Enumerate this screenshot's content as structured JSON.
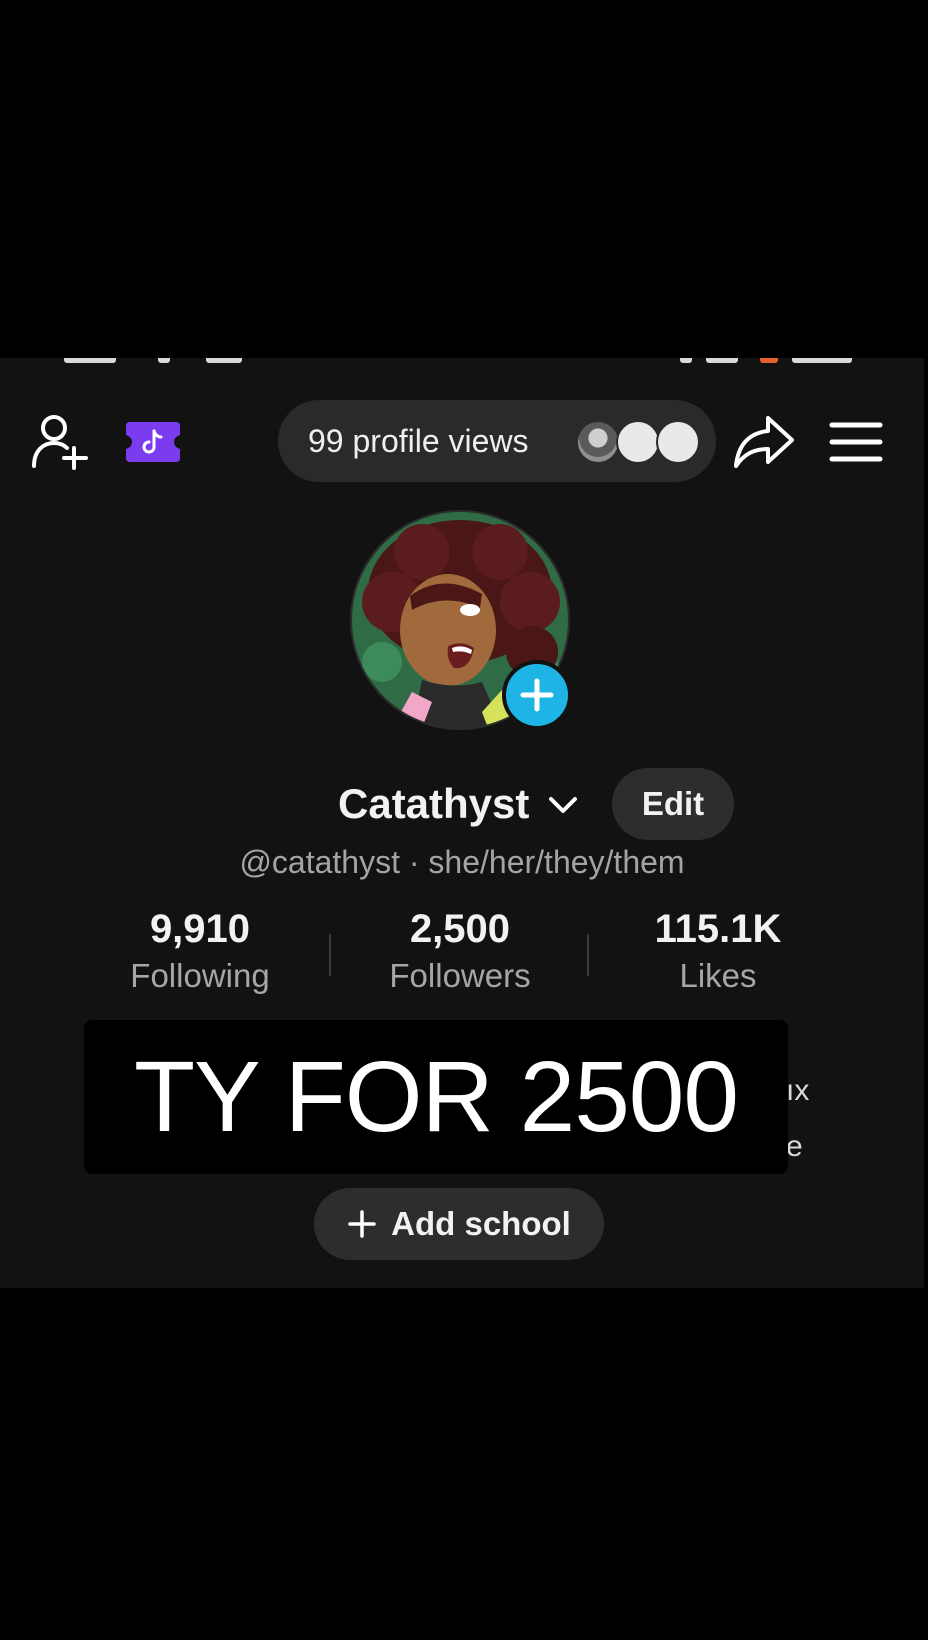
{
  "header": {
    "profile_views_label": "99 profile views"
  },
  "profile": {
    "display_name": "Catathyst",
    "edit_label": "Edit",
    "handle_line": "@catathyst · she/her/they/them"
  },
  "stats": [
    {
      "value": "9,910",
      "label": "Following"
    },
    {
      "value": "2,500",
      "label": "Followers"
    },
    {
      "value": "115.1K",
      "label": "Likes"
    }
  ],
  "bio_fragments": [
    "ıx",
    "e"
  ],
  "add_school_label": "Add school",
  "overlay": {
    "caption": "TY FOR 2500"
  },
  "colors": {
    "background": "#121212",
    "ticket_accent": "#7b3cf0",
    "add_photo_accent": "#1fb4e6"
  },
  "icons": [
    "add-friend-icon",
    "ticket-icon",
    "share-icon",
    "menu-icon",
    "chevron-down-icon",
    "plus-icon"
  ]
}
